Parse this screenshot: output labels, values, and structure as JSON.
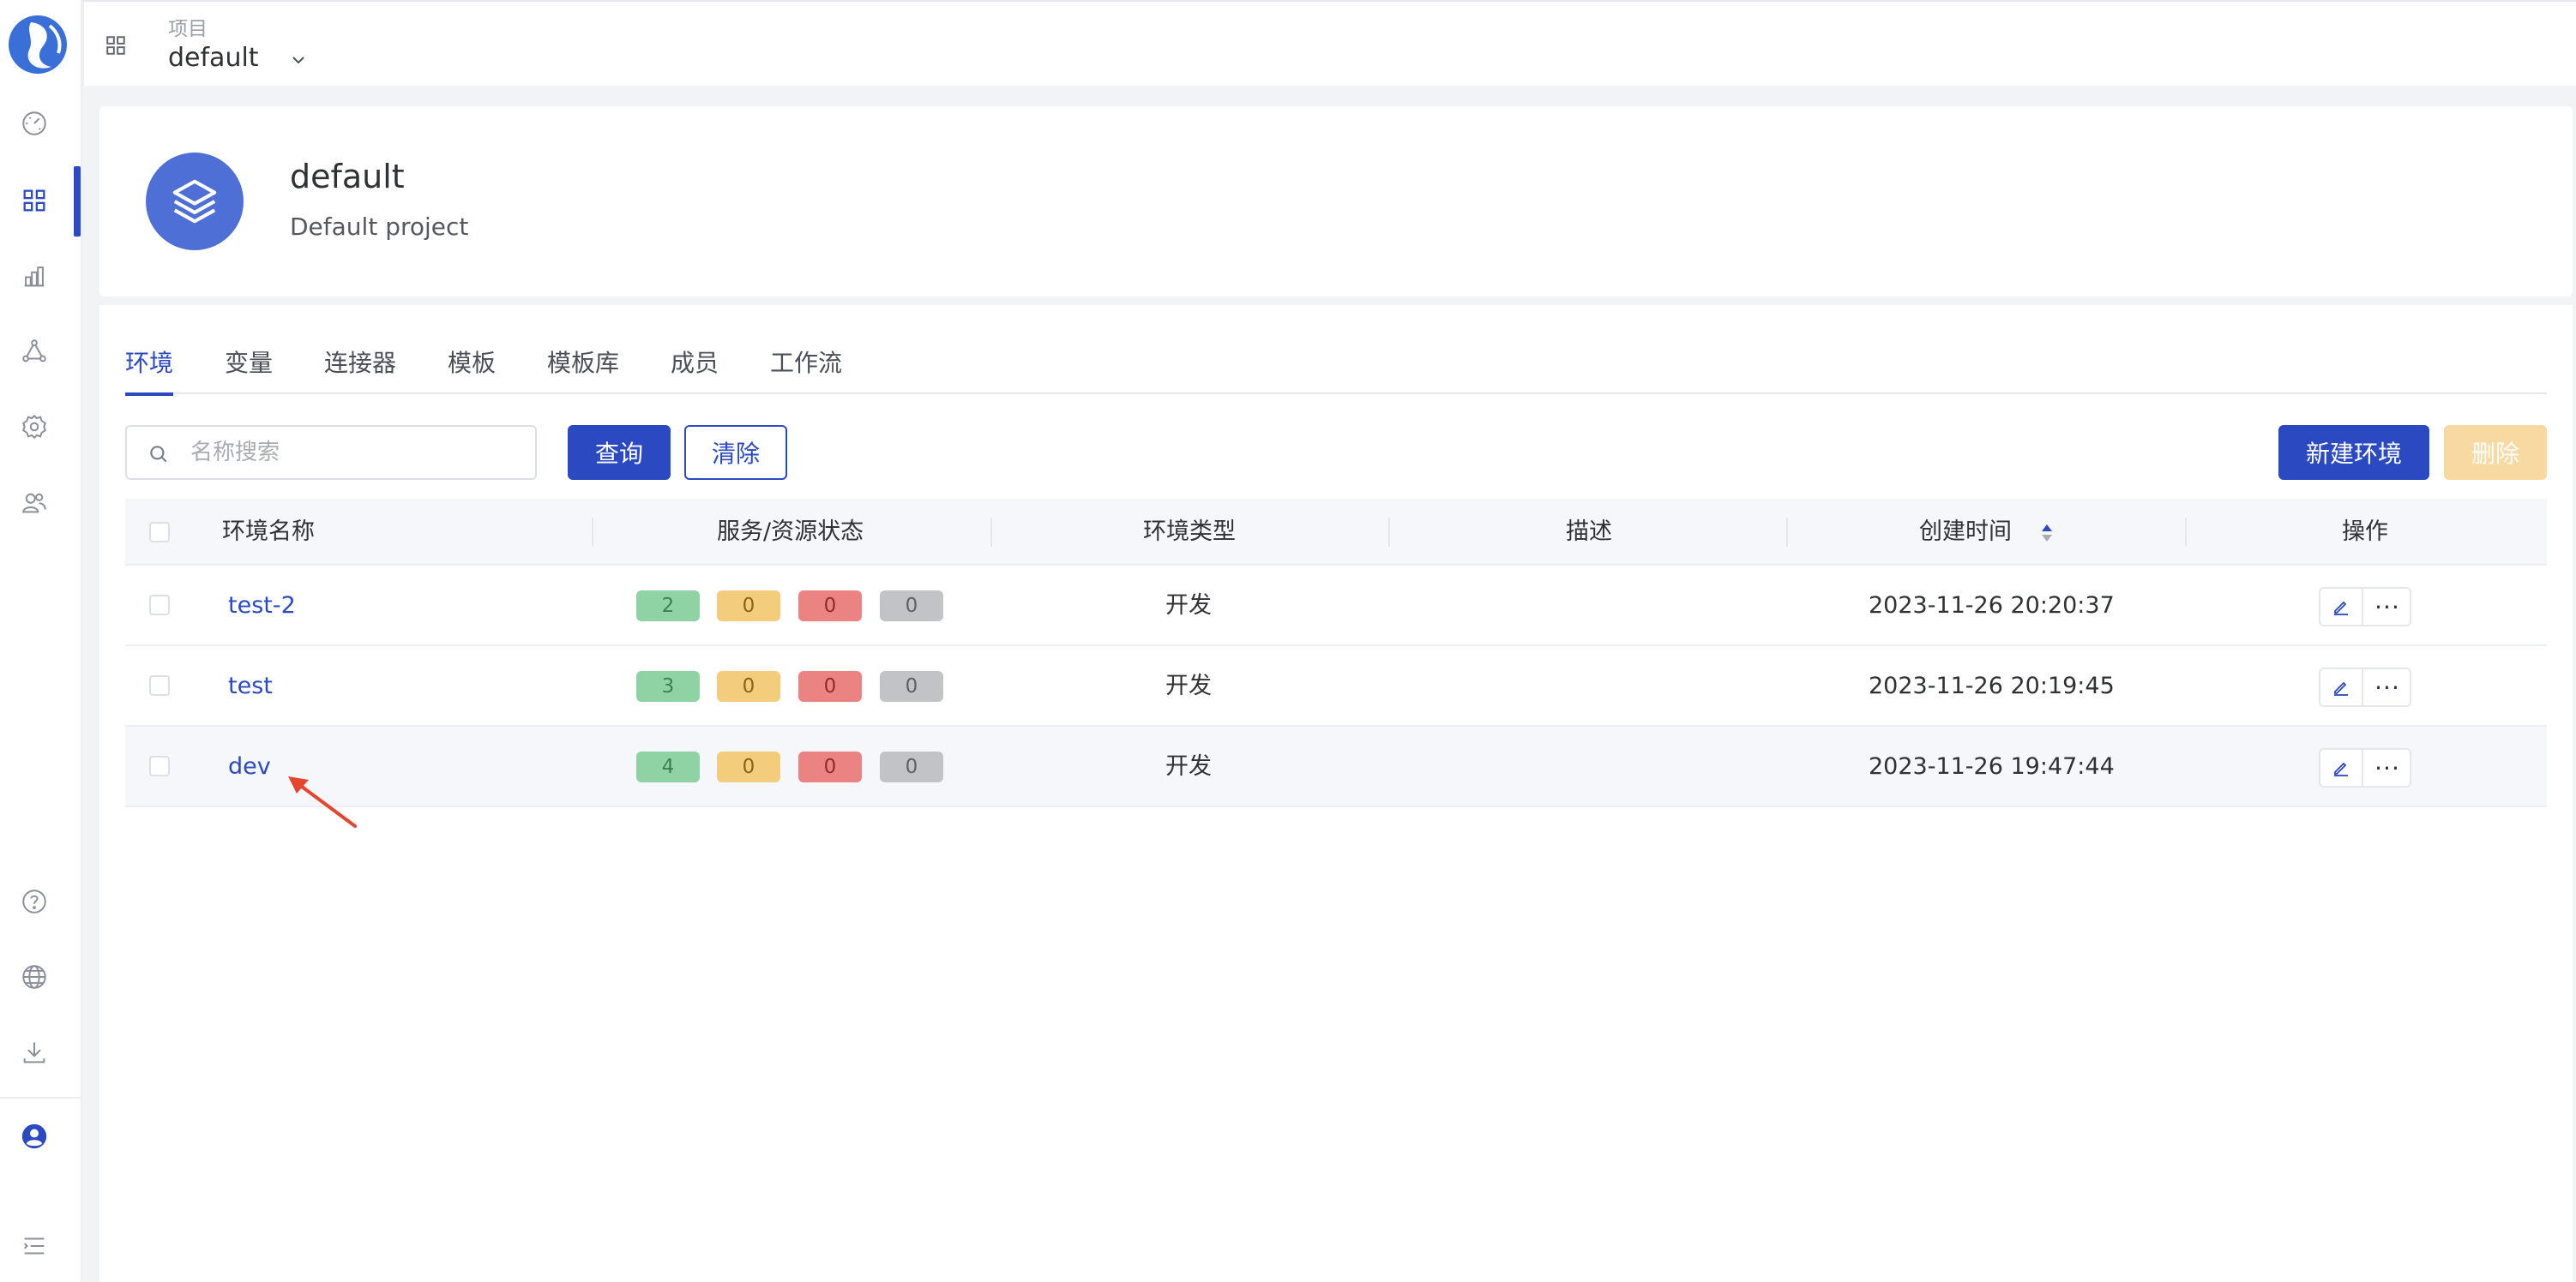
{
  "header": {
    "project_label": "项目",
    "project_value": "default"
  },
  "sidebar": {
    "items": [
      {
        "icon": "dashboard-icon"
      },
      {
        "icon": "apps-grid-icon",
        "active": true
      },
      {
        "icon": "bar-chart-icon"
      },
      {
        "icon": "network-icon"
      },
      {
        "icon": "gear-icon"
      },
      {
        "icon": "users-icon"
      },
      {
        "icon": "help-icon"
      },
      {
        "icon": "globe-icon"
      },
      {
        "icon": "download-icon"
      },
      {
        "icon": "user-avatar-icon"
      },
      {
        "icon": "menu-collapse-icon"
      }
    ]
  },
  "project": {
    "name": "default",
    "description": "Default project"
  },
  "tabs": [
    "环境",
    "变量",
    "连接器",
    "模板",
    "模板库",
    "成员",
    "工作流"
  ],
  "active_tab": "环境",
  "toolbar": {
    "search_placeholder": "名称搜索",
    "query_label": "查询",
    "clear_label": "清除",
    "new_label": "新建环境",
    "delete_label": "删除"
  },
  "table": {
    "columns": [
      "环境名称",
      "服务/资源状态",
      "环境类型",
      "描述",
      "创建时间",
      "操作"
    ],
    "rows": [
      {
        "name": "test-2",
        "status": [
          "2",
          "0",
          "0",
          "0"
        ],
        "type": "开发",
        "description": "",
        "created": "2023-11-26 20:20:37"
      },
      {
        "name": "test",
        "status": [
          "3",
          "0",
          "0",
          "0"
        ],
        "type": "开发",
        "description": "",
        "created": "2023-11-26 20:19:45"
      },
      {
        "name": "dev",
        "status": [
          "4",
          "0",
          "0",
          "0"
        ],
        "type": "开发",
        "description": "",
        "created": "2023-11-26 19:47:44"
      }
    ]
  },
  "colors": {
    "primary": "#2b49c0",
    "status_green": "#8fd3a4",
    "status_yellow": "#f3cd7c",
    "status_red": "#ec8383",
    "status_gray": "#c1c3c7",
    "annotation_arrow": "#e5452f"
  }
}
